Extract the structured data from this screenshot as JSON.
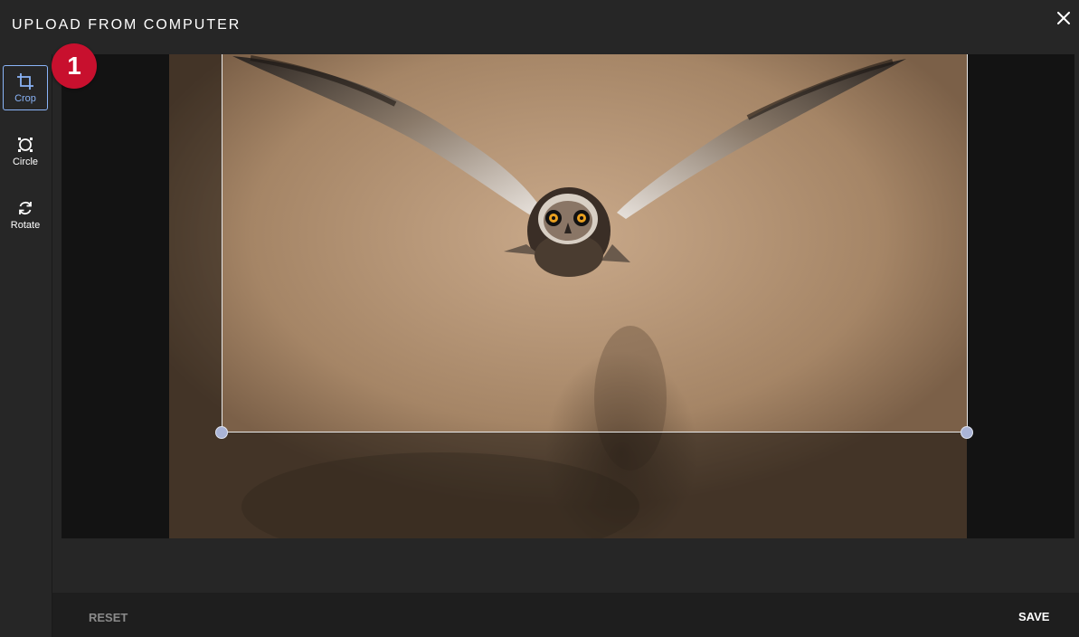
{
  "dialog": {
    "title": "UPLOAD FROM COMPUTER",
    "close_icon": "close-icon"
  },
  "step_badge": {
    "number": "1",
    "color": "#c8102e"
  },
  "tools": [
    {
      "label": "Crop",
      "icon": "crop-icon",
      "active": true
    },
    {
      "label": "Circle",
      "icon": "circle-crop-icon",
      "active": false
    },
    {
      "label": "Rotate",
      "icon": "rotate-icon",
      "active": false
    }
  ],
  "image": {
    "subject": "owl in flight",
    "alt": "Owl flying toward camera"
  },
  "footer": {
    "reset_label": "RESET",
    "save_label": "SAVE"
  },
  "colors": {
    "accent": "#8ab4f8",
    "background": "#262626",
    "canvas": "#131313",
    "handle": "#aab4d6"
  }
}
